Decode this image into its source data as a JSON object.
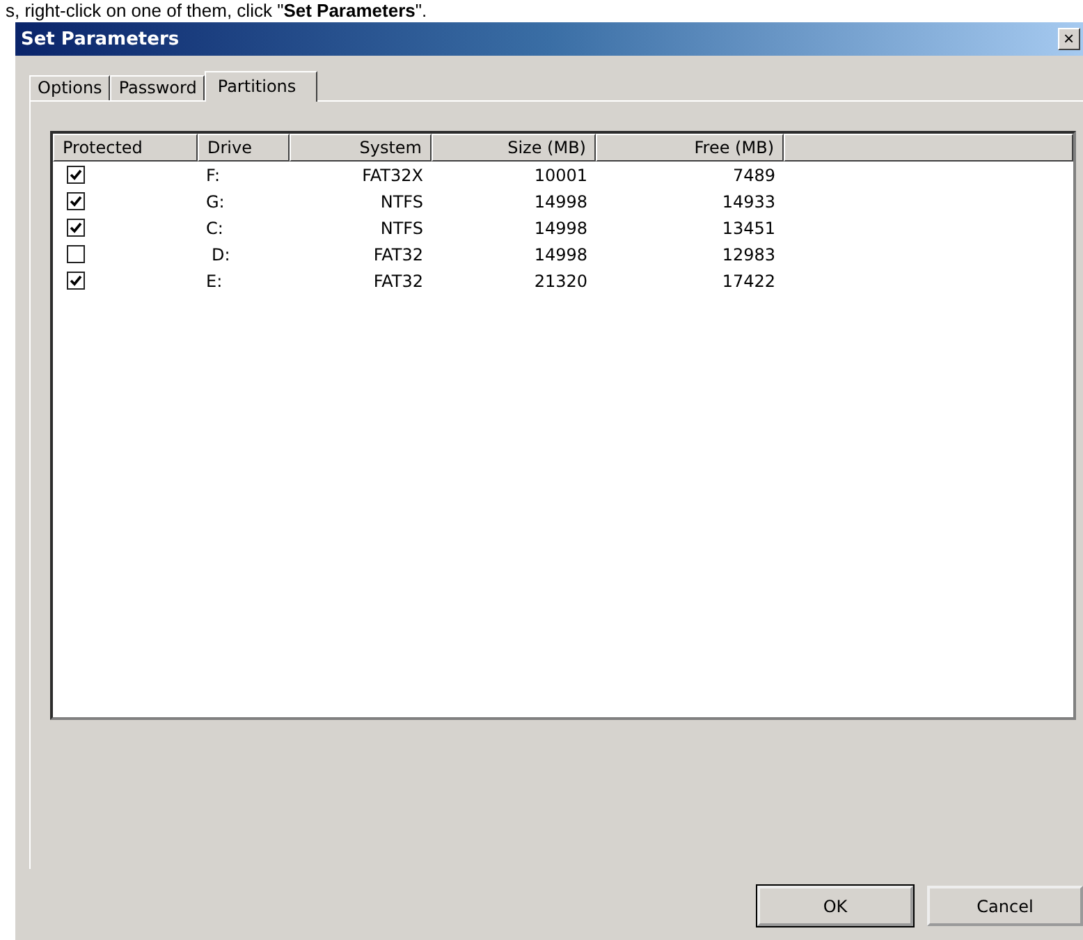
{
  "caption": "s, right-click on one of them, click \"**Set Parameters**\".",
  "window": {
    "title": "Set Parameters",
    "close": "×"
  },
  "tabs": [
    {
      "label": "Options",
      "selected": false
    },
    {
      "label": "Password",
      "selected": false
    },
    {
      "label": "Partitions",
      "selected": true
    }
  ],
  "table": {
    "columns": [
      "Protected",
      "Drive",
      "System",
      "Size (MB)",
      "Free (MB)"
    ],
    "rows": [
      {
        "checked": true,
        "drive": "F:",
        "system": "FAT32X",
        "size": "10001",
        "free": "7489"
      },
      {
        "checked": true,
        "drive": "G:",
        "system": "NTFS",
        "size": "14998",
        "free": "14933"
      },
      {
        "checked": true,
        "drive": "C:",
        "system": "NTFS",
        "size": "14998",
        "free": "13451"
      },
      {
        "checked": false,
        "drive": "D:",
        "system": "FAT32",
        "size": "14998",
        "free": "12983"
      },
      {
        "checked": true,
        "drive": "E:",
        "system": "FAT32",
        "size": "21320",
        "free": "17422"
      }
    ]
  },
  "buttons": [
    {
      "label": "OK",
      "default": true
    },
    {
      "label": "Cancel",
      "default": false
    }
  ]
}
